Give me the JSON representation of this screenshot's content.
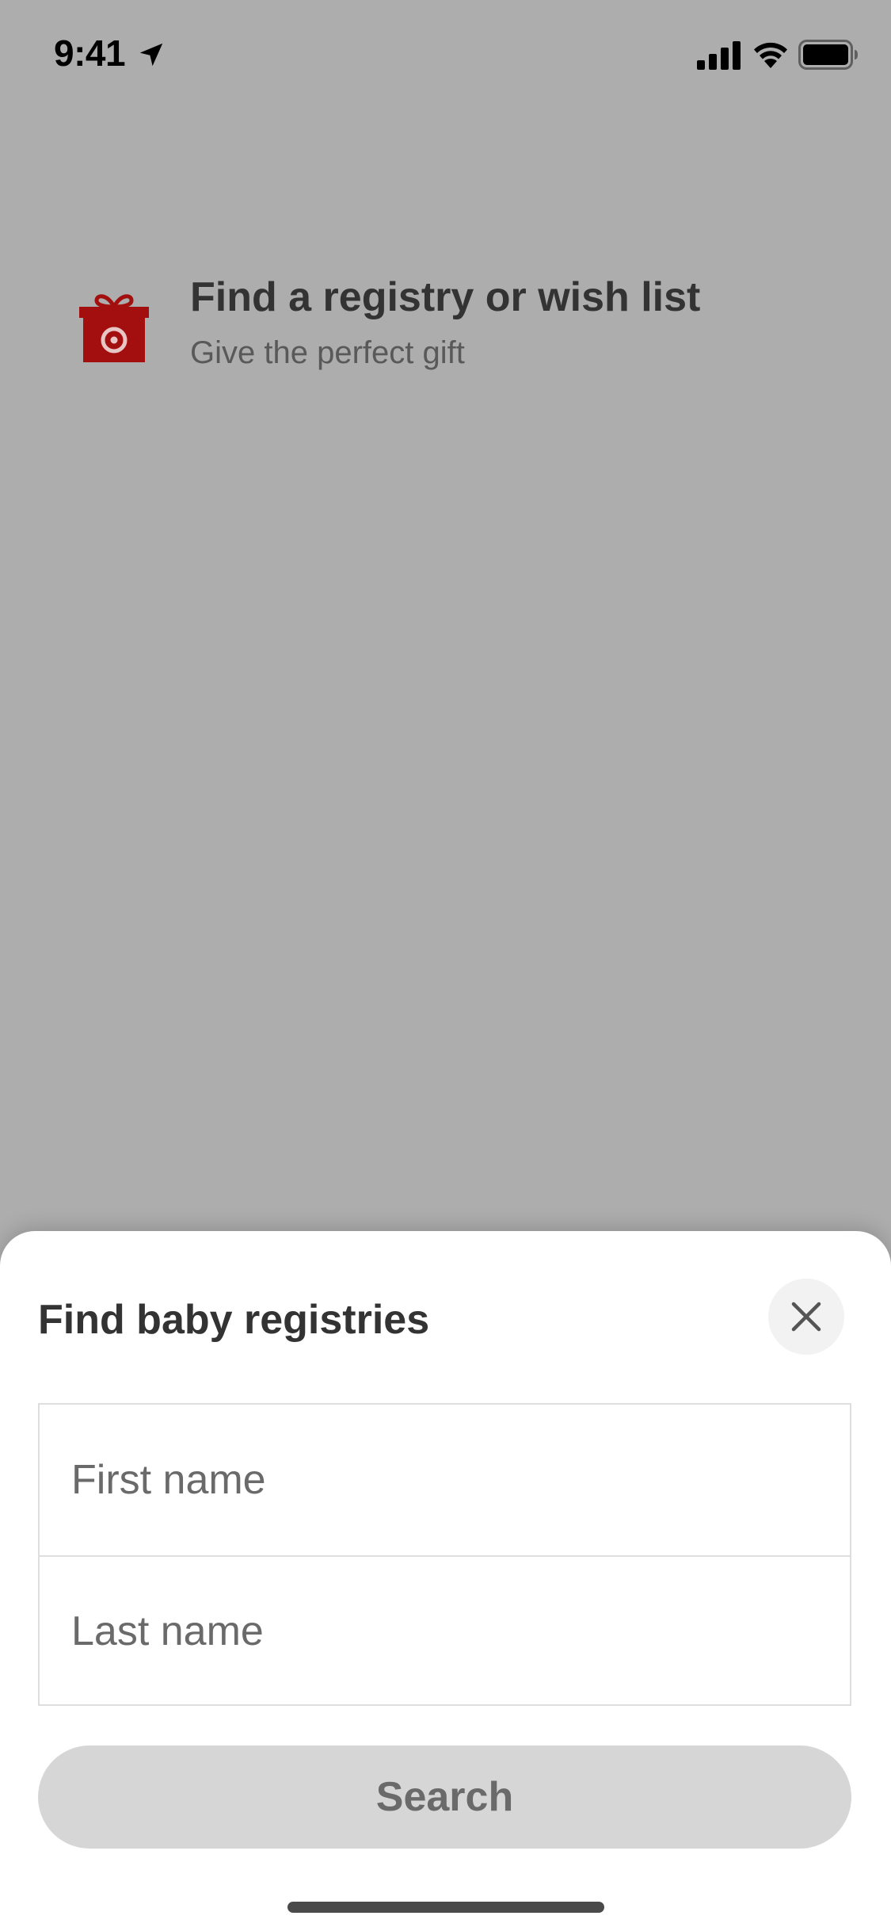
{
  "status_bar": {
    "time": "9:41",
    "icons": [
      "location-arrow-icon",
      "cellular-signal-icon",
      "wifi-icon",
      "battery-icon"
    ]
  },
  "registry_header": {
    "icon": "gift-icon",
    "title": "Find a registry or wish list",
    "subtitle": "Give the perfect gift"
  },
  "sheet": {
    "title": "Find baby registries",
    "close_icon": "close-icon",
    "first_name": {
      "value": "",
      "placeholder": "First name"
    },
    "last_name": {
      "value": "",
      "placeholder": "Last name"
    },
    "search_label": "Search"
  },
  "colors": {
    "overlay_background": "#acadac",
    "brand_red": "#b30000",
    "button_disabled_bg": "#d6d6d6",
    "button_disabled_text": "#6a6a6a"
  }
}
